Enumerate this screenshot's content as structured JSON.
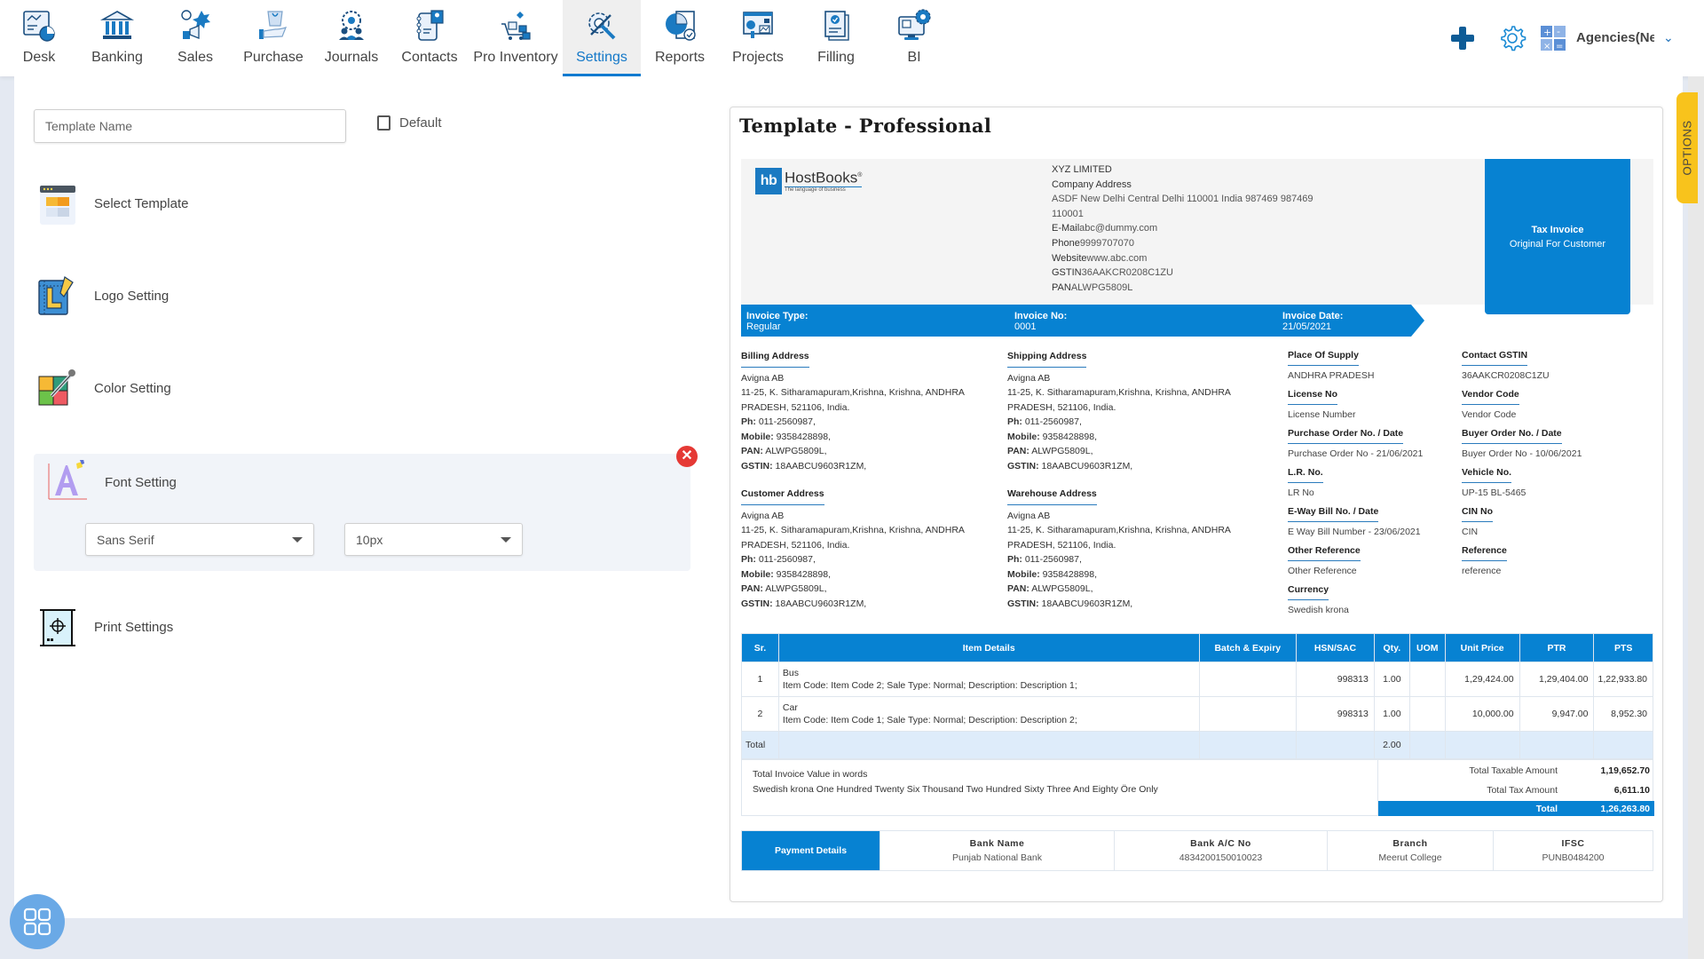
{
  "nav": {
    "items": [
      {
        "label": "Desk",
        "icon": "desk-dashboard-icon"
      },
      {
        "label": "Banking",
        "icon": "bank-building-icon"
      },
      {
        "label": "Sales",
        "icon": "sales-megaphone-icon"
      },
      {
        "label": "Purchase",
        "icon": "purchase-bag-hand-icon"
      },
      {
        "label": "Journals",
        "icon": "journals-team-gear-icon"
      },
      {
        "label": "Contacts",
        "icon": "contacts-book-icon"
      },
      {
        "label": "Pro Inventory",
        "icon": "inventory-cart-icon"
      },
      {
        "label": "Settings",
        "icon": "settings-tools-icon",
        "active": true
      },
      {
        "label": "Reports",
        "icon": "reports-pie-icon"
      },
      {
        "label": "Projects",
        "icon": "projects-board-icon"
      },
      {
        "label": "Filling",
        "icon": "filling-document-icon"
      },
      {
        "label": "BI",
        "icon": "bi-monitor-gear-icon"
      }
    ],
    "agency": "Agencies(New"
  },
  "left": {
    "template_name_placeholder": "Template Name",
    "default_label": "Default",
    "default_checked": false,
    "settings": [
      {
        "label": "Select Template"
      },
      {
        "label": "Logo Setting"
      },
      {
        "label": "Color Setting"
      },
      {
        "label": "Font Setting"
      },
      {
        "label": "Print Settings"
      }
    ],
    "font_family": "Sans Serif",
    "font_size": "10px",
    "close_symbol": "✕"
  },
  "preview": {
    "title": "Template - Professional",
    "logo": {
      "mark": "hb",
      "name": "HostBooks",
      "tagline": "The language of business"
    },
    "company": {
      "name": "XYZ LIMITED",
      "address_label": "Company Address",
      "address_line1": "ASDF New Delhi Central Delhi 110001 India 987469 987469",
      "address_line2": "110001",
      "email_label": "E-Mail",
      "email": "abc@dummy.com",
      "phone_label": "Phone",
      "phone": "9999707070",
      "website_label": "Website",
      "website": "www.abc.com",
      "gstin_label": "GSTIN",
      "gstin": "36AAKCR0208C1ZU",
      "pan_label": "PAN",
      "pan": "ALWPG5809L"
    },
    "tax_box": {
      "title": "Tax Invoice",
      "subtitle": "Original For Customer"
    },
    "invoice_bar": {
      "type_label": "Invoice Type:",
      "type": "Regular",
      "no_label": "Invoice No:",
      "no": "0001",
      "date_label": "Invoice Date:",
      "date": "21/05/2021"
    },
    "addresses": [
      {
        "heading": "Billing Address",
        "name": "Avigna AB",
        "line1": "11-25, K. Sitharamapuram,Krishna, Krishna, ANDHRA",
        "line2": "PRADESH, 521106, India.",
        "ph_label": "Ph:",
        "ph": "011-2560987,",
        "mobile_label": "Mobile:",
        "mobile": "9358428898,",
        "pan_label": "PAN:",
        "pan": "ALWPG5809L,",
        "gstin_label": "GSTIN:",
        "gstin": "18AABCU9603R1ZM,"
      },
      {
        "heading": "Shipping Address",
        "name": "Avigna AB",
        "line1": "11-25, K. Sitharamapuram,Krishna, Krishna, ANDHRA",
        "line2": "PRADESH, 521106, India.",
        "ph_label": "Ph:",
        "ph": "011-2560987,",
        "mobile_label": "Mobile:",
        "mobile": "9358428898,",
        "pan_label": "PAN:",
        "pan": "ALWPG5809L,",
        "gstin_label": "GSTIN:",
        "gstin": "18AABCU9603R1ZM,"
      },
      {
        "heading": "Customer Address",
        "name": "Avigna AB",
        "line1": "11-25, K. Sitharamapuram,Krishna, Krishna, ANDHRA",
        "line2": "PRADESH, 521106, India.",
        "ph_label": "Ph:",
        "ph": "011-2560987,",
        "mobile_label": "Mobile:",
        "mobile": "9358428898,",
        "pan_label": "PAN:",
        "pan": "ALWPG5809L,",
        "gstin_label": "GSTIN:",
        "gstin": "18AABCU9603R1ZM,"
      },
      {
        "heading": "Warehouse Address",
        "name": "Avigna AB",
        "line1": "11-25, K. Sitharamapuram,Krishna, Krishna, ANDHRA",
        "line2": "PRADESH, 521106, India.",
        "ph_label": "Ph:",
        "ph": "011-2560987,",
        "mobile_label": "Mobile:",
        "mobile": "9358428898,",
        "pan_label": "PAN:",
        "pan": "ALWPG5809L,",
        "gstin_label": "GSTIN:",
        "gstin": "18AABCU9603R1ZM,"
      }
    ],
    "meta_left": [
      {
        "label": "Place Of Supply",
        "value": "ANDHRA PRADESH"
      },
      {
        "label": "License No",
        "value": "License Number"
      },
      {
        "label": "Purchase Order No. / Date",
        "value": "Purchase Order No - 21/06/2021"
      },
      {
        "label": "L.R. No.",
        "value": "LR No"
      },
      {
        "label": "E-Way Bill No. / Date",
        "value": "E Way Bill Number - 23/06/2021"
      },
      {
        "label": "Other Reference",
        "value": "Other Reference"
      },
      {
        "label": "Currency",
        "value": "Swedish krona"
      }
    ],
    "meta_right": [
      {
        "label": "Contact GSTIN",
        "value": "36AAKCR0208C1ZU"
      },
      {
        "label": "Vendor Code",
        "value": "Vendor Code"
      },
      {
        "label": "Buyer Order No. / Date",
        "value": "Buyer Order No - 10/06/2021"
      },
      {
        "label": "Vehicle No.",
        "value": "UP-15 BL-5465"
      },
      {
        "label": "CIN No",
        "value": "CIN"
      },
      {
        "label": "Reference",
        "value": "reference"
      }
    ],
    "table": {
      "headers": [
        "Sr.",
        "Item Details",
        "Batch & Expiry",
        "HSN/SAC",
        "Qty.",
        "UOM",
        "Unit Price",
        "PTR",
        "PTS"
      ],
      "rows": [
        {
          "sr": "1",
          "name": "Bus",
          "details": "Item Code: Item Code 2; Sale Type: Normal; Description: Description 1;",
          "batch": "",
          "hsn": "998313",
          "qty": "1.00",
          "uom": "",
          "unit_price": "1,29,424.00",
          "ptr": "1,29,404.00",
          "pts": "1,22,933.80"
        },
        {
          "sr": "2",
          "name": "Car",
          "details": "Item Code: Item Code 1; Sale Type: Normal; Description: Description 2;",
          "batch": "",
          "hsn": "998313",
          "qty": "1.00",
          "uom": "",
          "unit_price": "10,000.00",
          "ptr": "9,947.00",
          "pts": "8,952.30"
        }
      ],
      "total_label": "Total",
      "total_qty": "2.00"
    },
    "summary": {
      "words_label": "Total Invoice Value in words",
      "words": "Swedish krona One Hundred Twenty Six Thousand Two Hundred Sixty Three And Eighty Öre Only",
      "taxable_label": "Total Taxable Amount",
      "taxable": "1,19,652.70",
      "tax_label": "Total Tax Amount",
      "tax": "6,611.10",
      "total_label": "Total",
      "total": "1,26,263.80"
    },
    "payment": {
      "heading": "Payment Details",
      "bank_name_label": "Bank Name",
      "bank_name": "Punjab National Bank",
      "account_label": "Bank A/C No",
      "account": "4834200150010023",
      "branch_label": "Branch",
      "branch": "Meerut College",
      "ifsc_label": "IFSC",
      "ifsc": "PUNB0484200"
    }
  },
  "options_tab": "OPTIONS",
  "colors": {
    "accent": "#0782d2",
    "options": "#f8c31c",
    "close": "#e53935"
  }
}
